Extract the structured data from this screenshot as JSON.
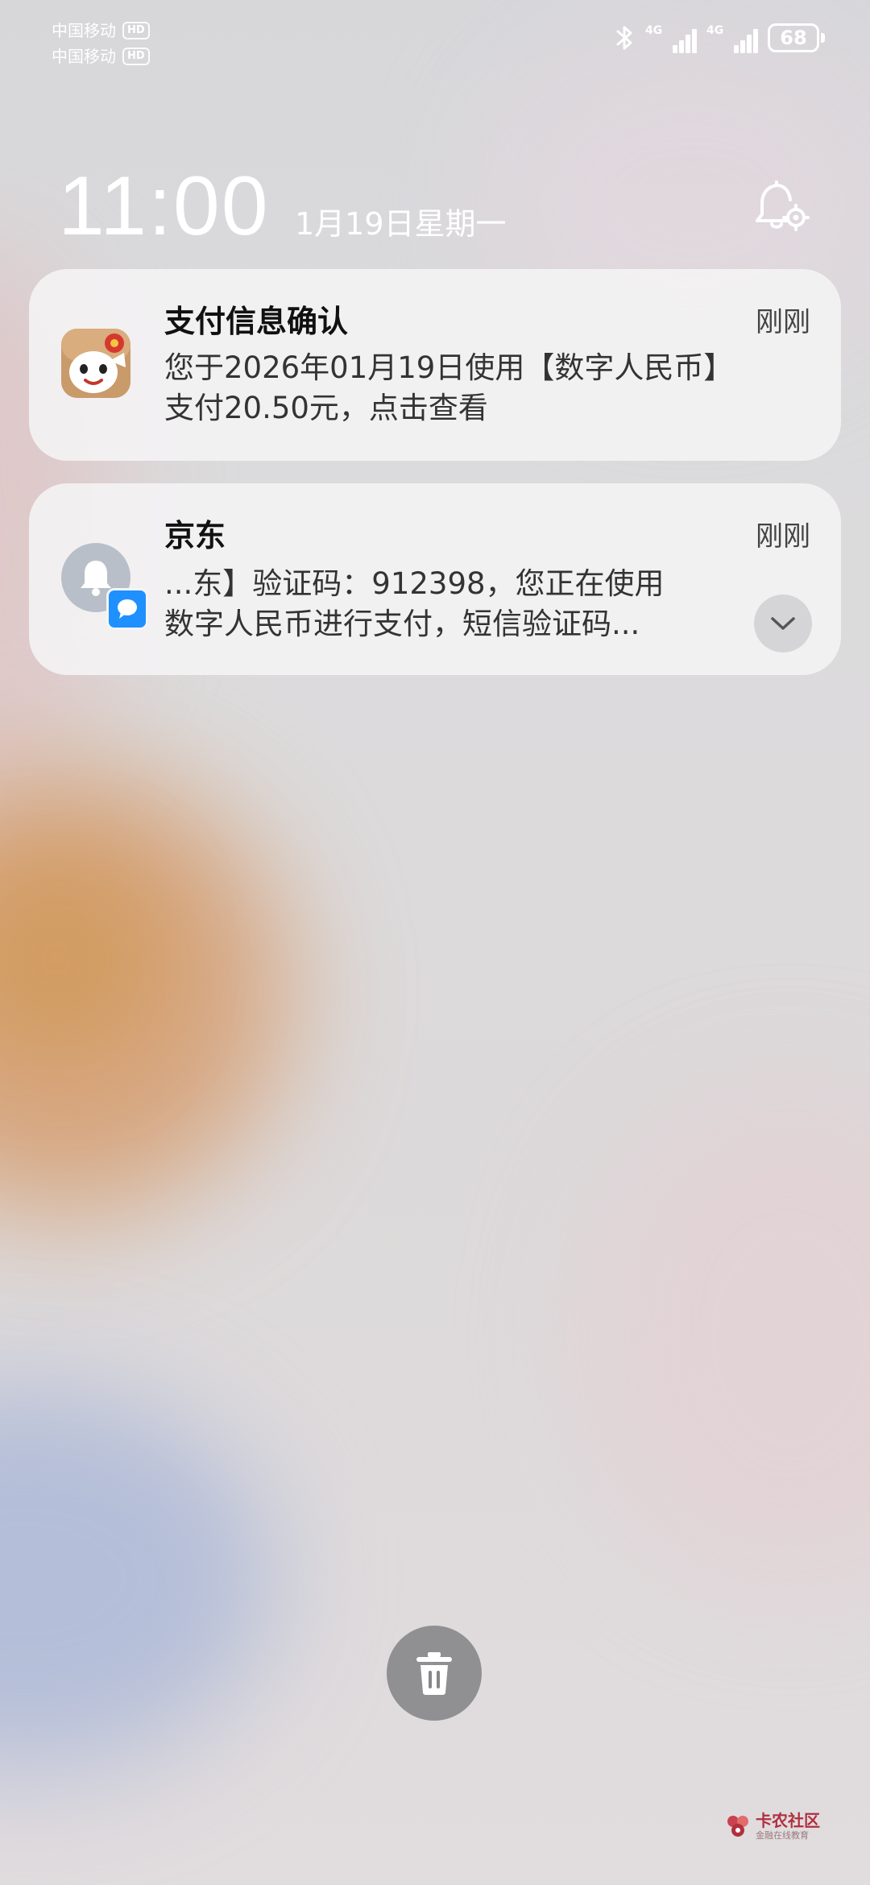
{
  "status_bar": {
    "carriers": [
      {
        "name": "中国移动",
        "badge": "HD"
      },
      {
        "name": "中国移动",
        "badge": "HD"
      }
    ],
    "signals": [
      {
        "network": "4G",
        "bars": 4
      },
      {
        "network": "4G",
        "bars": 4
      }
    ],
    "battery_level": "68",
    "icons": [
      "bluetooth-icon",
      "signal-icon",
      "battery-icon"
    ]
  },
  "lockscreen": {
    "time": "11:00",
    "date": "1月19日星期一"
  },
  "notifications": [
    {
      "app_icon": "jd-mascot-icon",
      "title": "支付信息确认",
      "time": "刚刚",
      "body_lines": [
        "您于2026年01月19日使用【数字人民币】",
        "支付20.50元，点击查看"
      ]
    },
    {
      "app_icon": "bell-icon",
      "badge_icon": "message-icon",
      "title": "京东",
      "time": "刚刚",
      "body_lines": [
        "...东】验证码：912398，您正在使用",
        "数字人民币进行支付，短信验证码..."
      ]
    }
  ],
  "watermark": {
    "title": "卡农社区",
    "subtitle": "金融在线教育"
  },
  "colors": {
    "card_bg": "#f5f4f5",
    "accent_blue": "#1e90ff",
    "trash_button": "#87878a"
  }
}
